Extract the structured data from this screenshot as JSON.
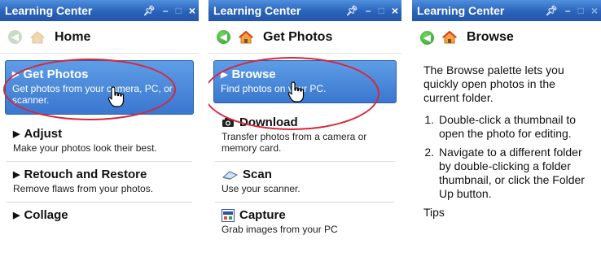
{
  "panels": [
    {
      "title": "Learning Center",
      "nav_title": "Home",
      "items": [
        {
          "title": "Get Photos",
          "desc": "Get photos from your camera, PC, or scanner."
        },
        {
          "title": "Adjust",
          "desc": "Make your photos look their best."
        },
        {
          "title": "Retouch and Restore",
          "desc": "Remove flaws from your photos."
        },
        {
          "title": "Collage",
          "desc": ""
        }
      ]
    },
    {
      "title": "Learning Center",
      "nav_title": "Get Photos",
      "items": [
        {
          "title": "Browse",
          "desc": "Find photos on your PC."
        },
        {
          "title": "Download",
          "desc": "Transfer photos from a camera or memory card."
        },
        {
          "title": "Scan",
          "desc": "Use your scanner."
        },
        {
          "title": "Capture",
          "desc": "Grab images from your PC"
        }
      ]
    },
    {
      "title": "Learning Center",
      "nav_title": "Browse",
      "intro": "The Browse palette lets you quickly open photos in the current folder.",
      "steps": [
        "Double-click a thumbnail to open the photo for editing.",
        "Navigate to a different folder by double-clicking a folder thumbnail, or click the Folder Up button."
      ],
      "trailing": "Tips"
    }
  ],
  "titlebar_controls": {
    "pin": "ꟷ",
    "minimize": "–",
    "maximize": "□",
    "close": "×"
  },
  "icons": {
    "back": "back-arrow-icon",
    "home": "home-icon",
    "camera": "camera-icon",
    "scanner": "scanner-icon",
    "capture": "capture-icon",
    "cursor": "hand-pointer-cursor"
  },
  "colors": {
    "titlebar": "#2a63bb",
    "selected_item": "#4a86d8",
    "highlight_oval": "#d9253a",
    "back_button": "#2e9d2b"
  }
}
